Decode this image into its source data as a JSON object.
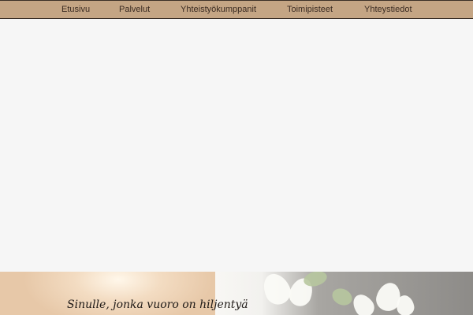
{
  "nav": {
    "items": [
      {
        "label": "Etusivu"
      },
      {
        "label": "Palvelut"
      },
      {
        "label": "Yhteistyökumppanit"
      },
      {
        "label": "Toimipisteet"
      },
      {
        "label": "Yhteystiedot"
      }
    ]
  },
  "hero": {
    "tagline": "Sinulle, jonka vuoro on hiljentyä"
  },
  "colors": {
    "nav_background": "#c4a584",
    "nav_border": "#3b2f26",
    "page_background": "#f6f6f6"
  }
}
